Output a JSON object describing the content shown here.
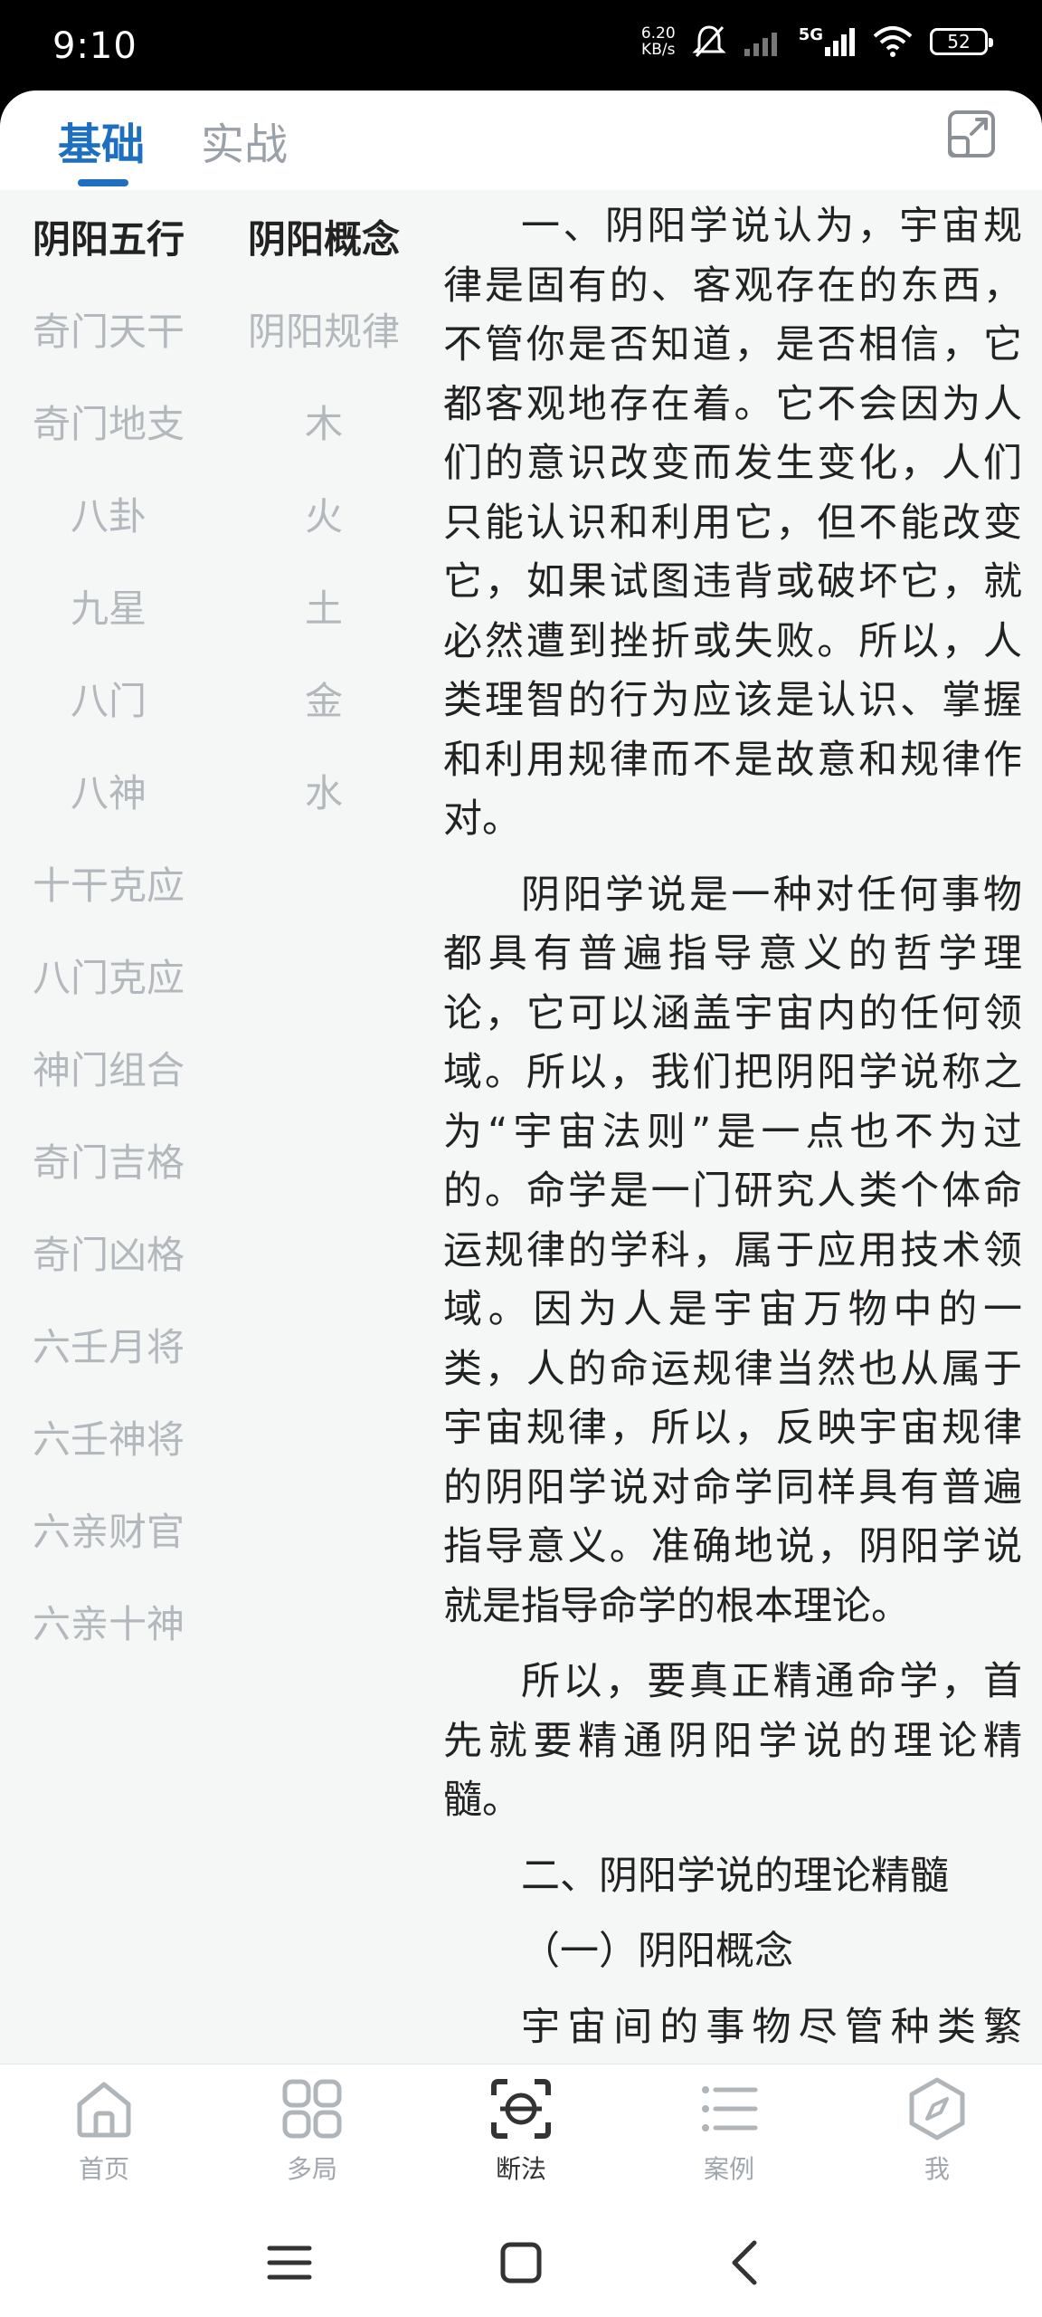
{
  "status": {
    "time": "9:10",
    "net_speed_value": "6.20",
    "net_speed_unit": "KB/s",
    "network": "5G",
    "battery": "52"
  },
  "tabs": [
    {
      "label": "基础"
    },
    {
      "label": "实战"
    }
  ],
  "category_nav": [
    "阴阳五行",
    "奇门天干",
    "奇门地支",
    "八卦",
    "九星",
    "八门",
    "八神",
    "十干克应",
    "八门克应",
    "神门组合",
    "奇门吉格",
    "奇门凶格",
    "六壬月将",
    "六壬神将",
    "六亲财官",
    "六亲十神"
  ],
  "topic_nav": [
    "阴阳概念",
    "阴阳规律",
    "木",
    "火",
    "土",
    "金",
    "水"
  ],
  "article": {
    "paragraphs": [
      "一、阴阳学说认为，宇宙规律是固有的、客观存在的东西，不管你是否知道，是否相信，它都客观地存在着。它不会因为人们的意识改变而发生变化，人们只能认识和利用它，但不能改变它，如果试图违背或破坏它，就必然遭到挫折或失败。所以，人类理智的行为应该是认识、掌握和利用规律而不是故意和规律作对。",
      "阴阳学说是一种对任何事物都具有普遍指导意义的哲学理论，它可以涵盖宇宙内的任何领域。所以，我们把阴阳学说称之为“宇宙法则”是一点也不为过的。命学是一门研究人类个体命运规律的学科，属于应用技术领域。因为人是宇宙万物中的一类，人的命运规律当然也从属于宇宙规律，所以，反映宇宙规律的阴阳学说对命学同样具有普遍指导意义。准确地说，阴阳学说就是指导命学的根本理论。",
      "所以，要真正精通命学，首先就要精通阴阳学说的理论精髓。",
      "二、阴阳学说的理论精髓",
      "（一）阴阳概念",
      "宇宙间的事物尽管种类繁多，千姿百态，但如果按照相反的属性归类，都可以分为阴阳两大类。"
    ]
  },
  "bottom_nav": [
    {
      "label": "首页",
      "icon": "home-icon"
    },
    {
      "label": "多局",
      "icon": "grid-icon"
    },
    {
      "label": "断法",
      "icon": "scan-icon"
    },
    {
      "label": "案例",
      "icon": "list-icon"
    },
    {
      "label": "我",
      "icon": "compass-icon"
    }
  ]
}
